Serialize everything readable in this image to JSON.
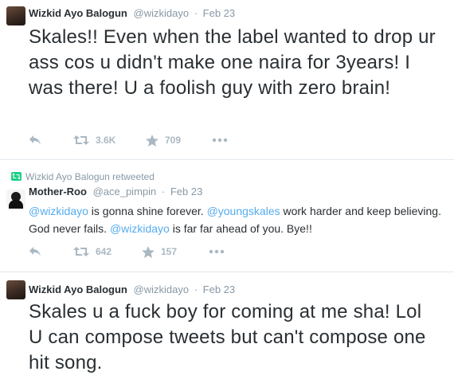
{
  "tweets": [
    {
      "name": "Wizkid Ayo Balogun",
      "handle": "@wizkidayo",
      "dot": "·",
      "time": "Feb 23",
      "text": "Skales!! Even when the label wanted to drop ur ass cos u didn't make one naira for 3years! I was there! U a foolish guy with zero brain!",
      "retweets": "3.6K",
      "favorites": "709"
    },
    {
      "retweeted_by": "Wizkid Ayo Balogun retweeted",
      "name": "Mother-Roo",
      "handle": "@ace_pimpin",
      "dot": "·",
      "time": "Feb 23",
      "text_parts": {
        "m1": "@wizkidayo",
        "t1": " is gonna shine forever. ",
        "m2": "@youngskales",
        "t2": " work harder and keep believing. God never fails. ",
        "m3": "@wizkidayo",
        "t3": " is far far ahead of you. Bye!!"
      },
      "retweets": "642",
      "favorites": "157"
    },
    {
      "name": "Wizkid Ayo Balogun",
      "handle": "@wizkidayo",
      "dot": "·",
      "time": "Feb 23",
      "text": "Skales u a fuck boy for coming at me sha! Lol   U can compose tweets but can't compose one hit song."
    }
  ],
  "icons": {
    "reply": "reply-icon",
    "retweet": "retweet-icon",
    "favorite": "star-icon",
    "more": "more-icon"
  },
  "colors": {
    "link": "#55acee",
    "retweet_green": "#19cf86",
    "muted": "#8899a6",
    "action_gray": "#aab8c2"
  }
}
